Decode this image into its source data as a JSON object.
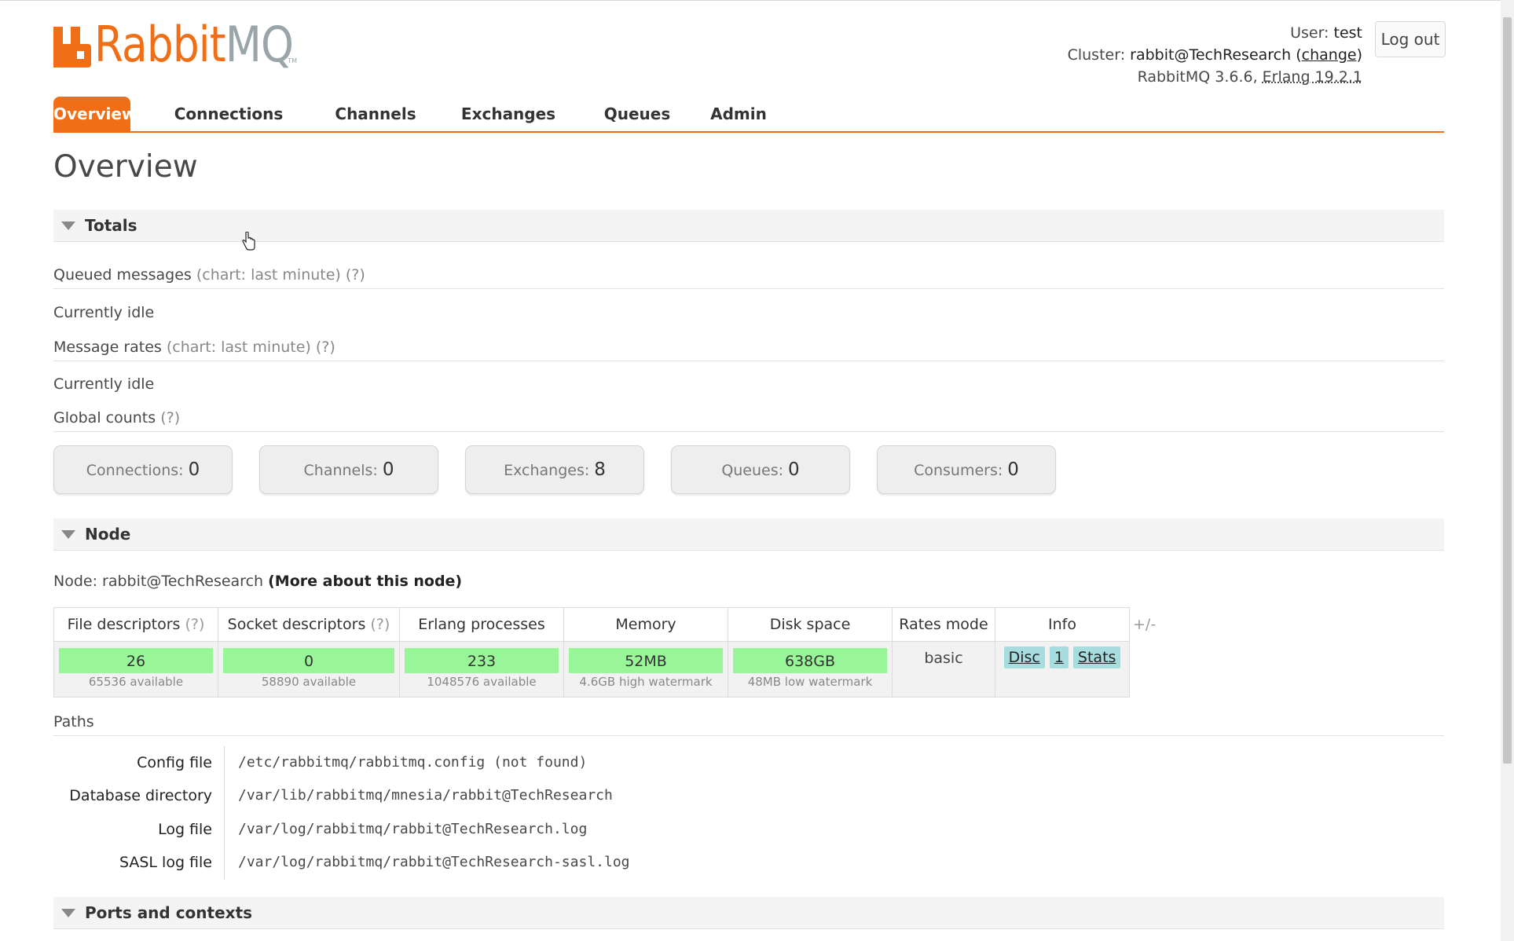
{
  "header": {
    "logo": {
      "brand_part1": "Rabbit",
      "brand_part2": "MQ",
      "tm": "TM"
    },
    "user_label": "User:",
    "user_value": "test",
    "cluster_label": "Cluster:",
    "cluster_value": "rabbit@TechResearch",
    "cluster_change_open": "(",
    "cluster_change_link": "change",
    "cluster_change_close": ")",
    "version_text": "RabbitMQ 3.6.6,",
    "erlang_text": "Erlang 19.2.1",
    "logout_label": "Log out"
  },
  "tabs": [
    {
      "label": "Overview",
      "active": true
    },
    {
      "label": "Connections",
      "active": false
    },
    {
      "label": "Channels",
      "active": false
    },
    {
      "label": "Exchanges",
      "active": false
    },
    {
      "label": "Queues",
      "active": false
    },
    {
      "label": "Admin",
      "active": false
    }
  ],
  "page_title": "Overview",
  "totals": {
    "title": "Totals",
    "queued_messages": {
      "label": "Queued messages",
      "suffix": "(chart: last minute) (?)",
      "status": "Currently idle"
    },
    "message_rates": {
      "label": "Message rates",
      "suffix": "(chart: last minute) (?)",
      "status": "Currently idle"
    },
    "global_counts": {
      "label": "Global counts",
      "suffix": "(?)"
    },
    "counts": [
      {
        "label": "Connections:",
        "value": "0"
      },
      {
        "label": "Channels:",
        "value": "0"
      },
      {
        "label": "Exchanges:",
        "value": "8"
      },
      {
        "label": "Queues:",
        "value": "0"
      },
      {
        "label": "Consumers:",
        "value": "0"
      }
    ]
  },
  "node": {
    "title": "Node",
    "node_label": "Node:",
    "node_name": "rabbit@TechResearch",
    "more_link": "(More about this node)",
    "table": {
      "headers": {
        "file_descriptors": "File descriptors",
        "file_descriptors_help": "(?)",
        "socket_descriptors": "Socket descriptors",
        "socket_descriptors_help": "(?)",
        "erlang_processes": "Erlang processes",
        "memory": "Memory",
        "disk_space": "Disk space",
        "rates_mode": "Rates mode",
        "info": "Info"
      },
      "row": {
        "file_descriptors": {
          "value": "26",
          "sub": "65536 available"
        },
        "socket_descriptors": {
          "value": "0",
          "sub": "58890 available"
        },
        "erlang_processes": {
          "value": "233",
          "sub": "1048576 available"
        },
        "memory": {
          "value": "52MB",
          "sub": "4.6GB high watermark"
        },
        "disk_space": {
          "value": "638GB",
          "sub": "48MB low watermark"
        },
        "rates_mode": "basic",
        "info_badges": [
          "Disc",
          "1",
          "Stats"
        ]
      },
      "toggle_columns": "+/-"
    },
    "paths": {
      "title": "Paths",
      "rows": [
        {
          "label": "Config file",
          "value": "/etc/rabbitmq/rabbitmq.config (not found)"
        },
        {
          "label": "Database directory",
          "value": "/var/lib/rabbitmq/mnesia/rabbit@TechResearch"
        },
        {
          "label": "Log file",
          "value": "/var/log/rabbitmq/rabbit@TechResearch.log"
        },
        {
          "label": "SASL log file",
          "value": "/var/log/rabbitmq/rabbit@TechResearch-sasl.log"
        }
      ]
    }
  },
  "ports": {
    "title": "Ports and contexts"
  },
  "colors": {
    "accent": "#f06f16",
    "logo_grey": "#99a5a8",
    "bar_green": "#98f598",
    "badge_blue": "#a8dde0"
  },
  "icons": {
    "cursor": "hand-pointer-icon",
    "section_toggle": "triangle-down-icon"
  }
}
